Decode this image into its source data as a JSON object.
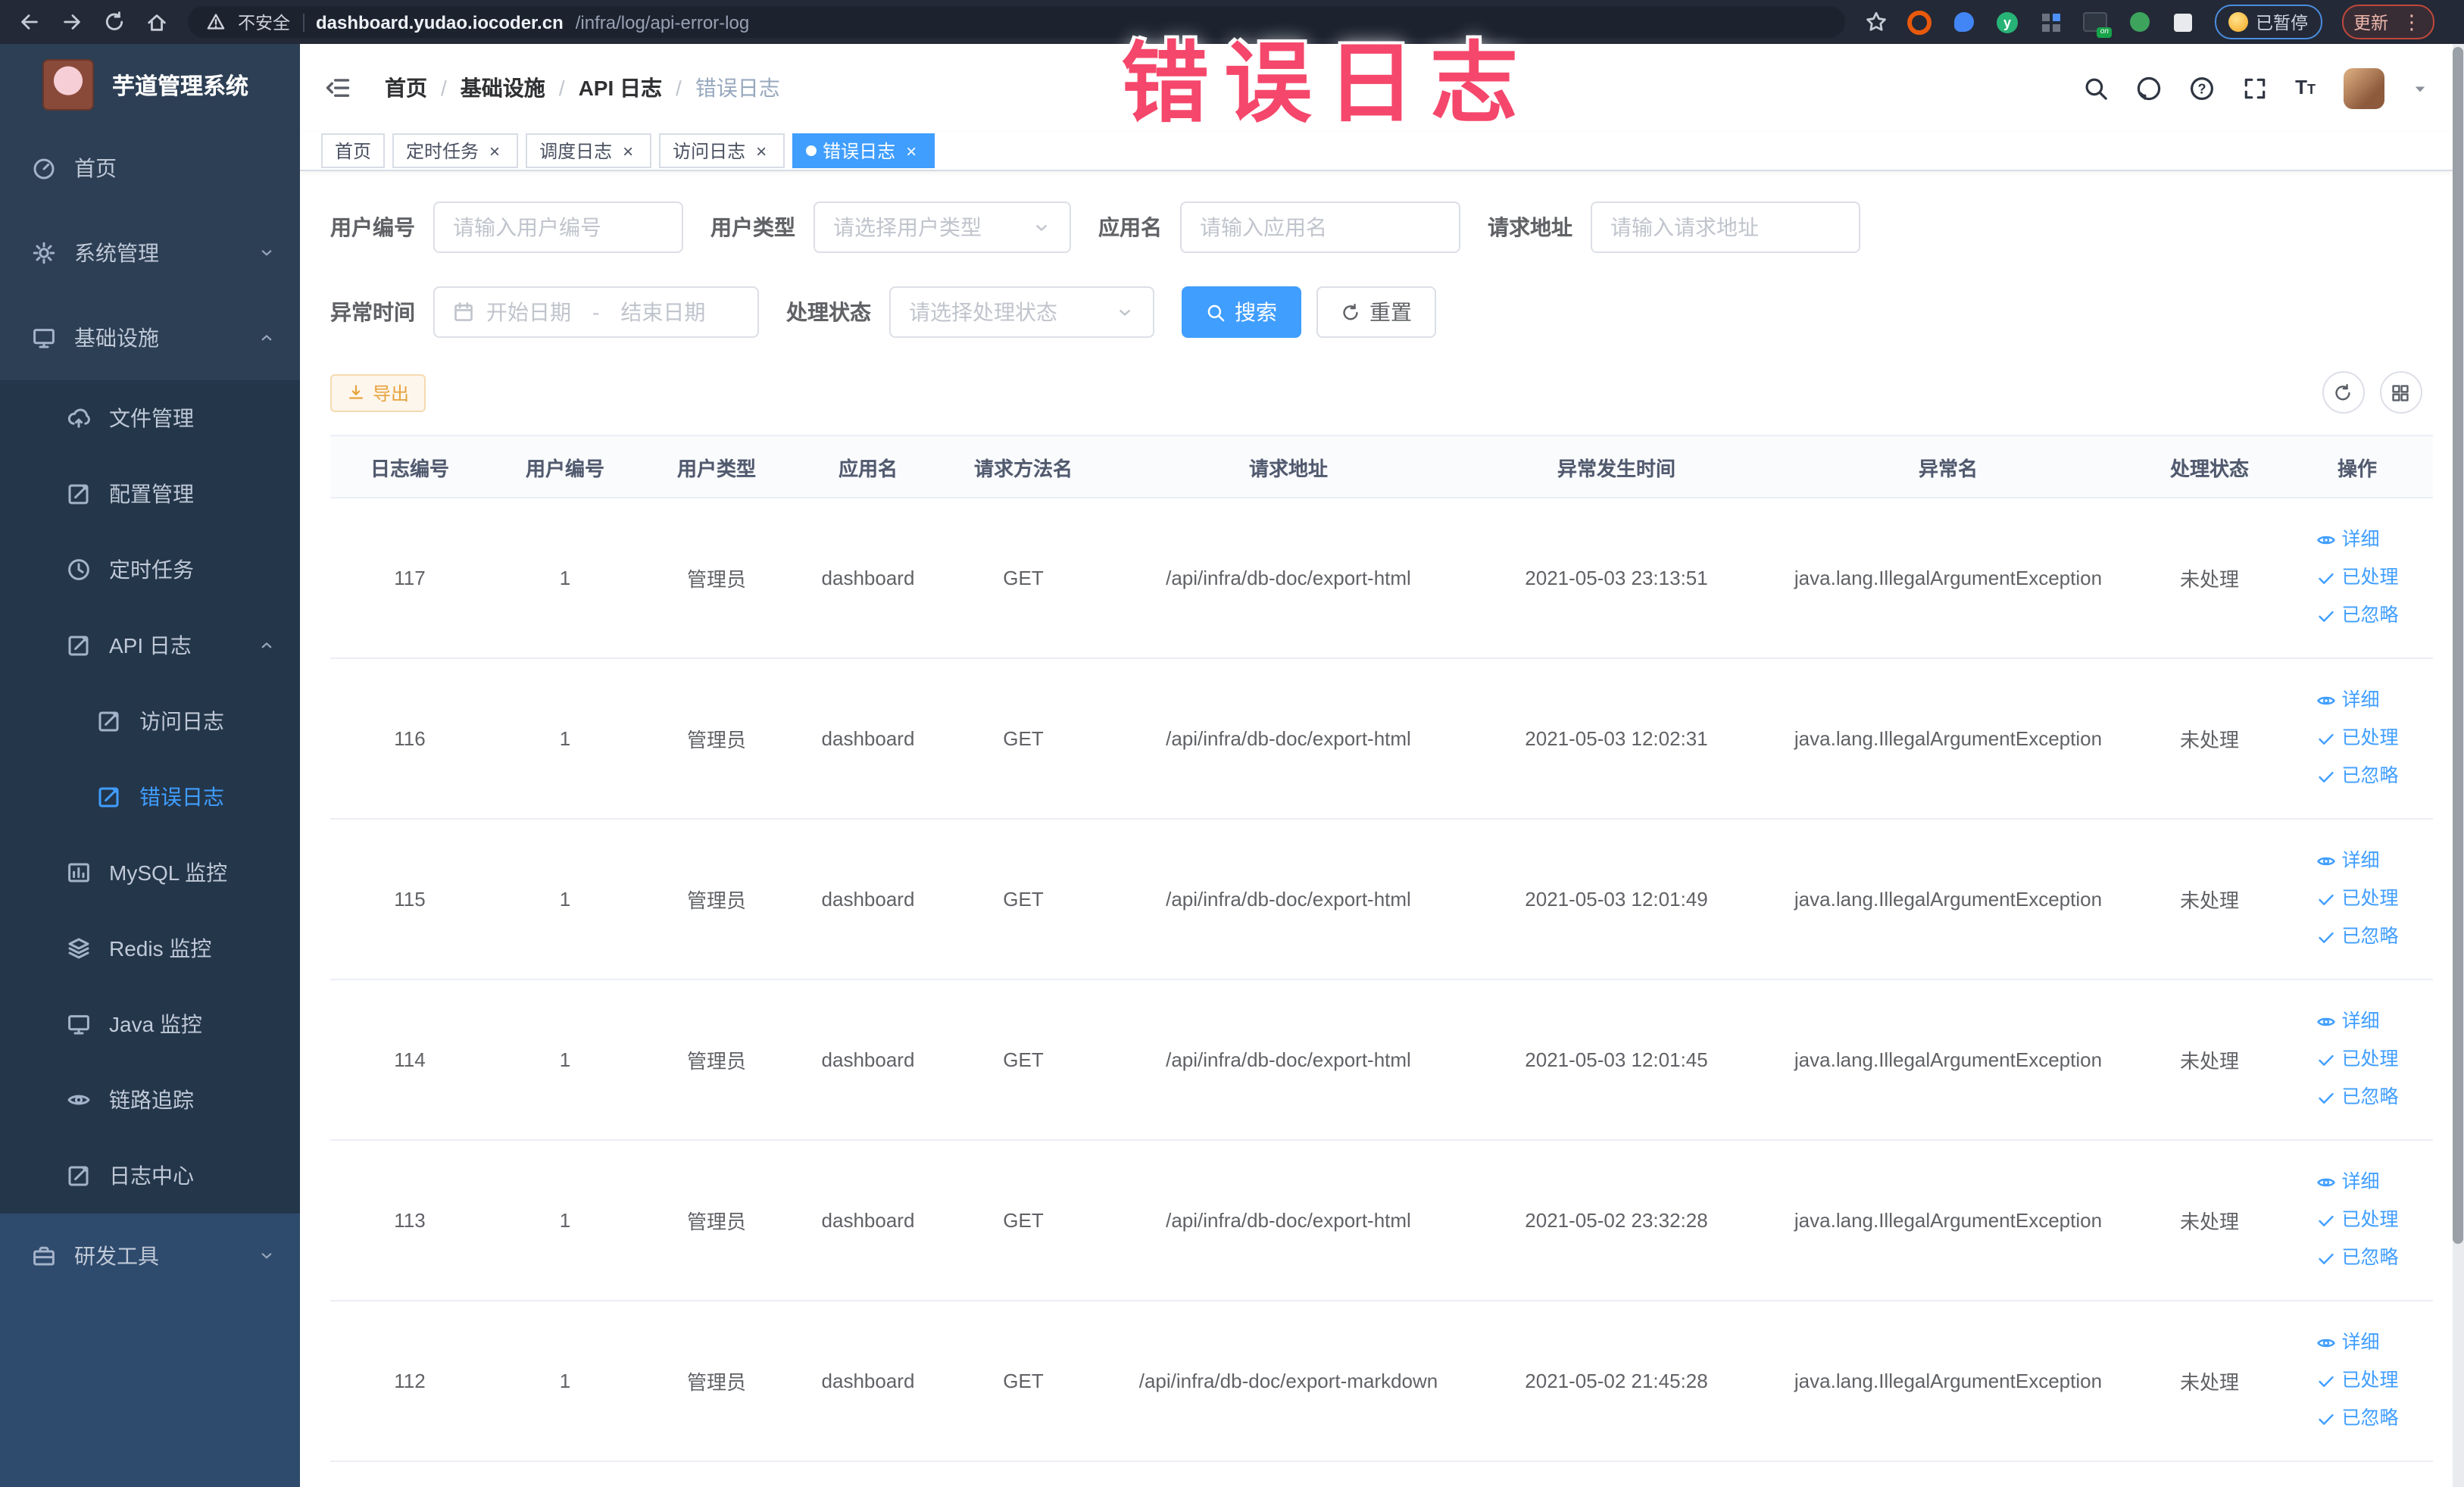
{
  "browser": {
    "security_label": "不安全",
    "url_host": "dashboard.yudao.iocoder.cn",
    "url_path": "/infra/log/api-error-log",
    "paused_label": "已暂停",
    "update_label": "更新"
  },
  "app": {
    "title": "芋道管理系统"
  },
  "watermark": {
    "text": "错误日志",
    "color": "#f5476b"
  },
  "colors": {
    "accent": "#409eff",
    "warning": "#e6a23c",
    "sidebar": "#2d3f54",
    "sidebar_sub": "#24364a",
    "sidebar_dev": "#2e4a6c"
  },
  "sidebar": {
    "items": [
      {
        "label": "首页",
        "icon": "dashboard",
        "level": 1,
        "section": "base"
      },
      {
        "label": "系统管理",
        "icon": "gear",
        "level": 1,
        "section": "base",
        "chevron": "down"
      },
      {
        "label": "基础设施",
        "icon": "monitor",
        "level": 1,
        "section": "base",
        "chevron": "up"
      },
      {
        "label": "文件管理",
        "icon": "cloud",
        "level": 2,
        "section": "sub"
      },
      {
        "label": "配置管理",
        "icon": "edit",
        "level": 2,
        "section": "sub"
      },
      {
        "label": "定时任务",
        "icon": "clock",
        "level": 2,
        "section": "sub"
      },
      {
        "label": "API 日志",
        "icon": "edit",
        "level": 2,
        "section": "sub",
        "chevron": "up"
      },
      {
        "label": "访问日志",
        "icon": "edit",
        "level": 3,
        "section": "sub"
      },
      {
        "label": "错误日志",
        "icon": "edit",
        "level": 3,
        "section": "sub",
        "active": true
      },
      {
        "label": "MySQL 监控",
        "icon": "chart",
        "level": 2,
        "section": "sub"
      },
      {
        "label": "Redis 监控",
        "icon": "layers",
        "level": 2,
        "section": "sub"
      },
      {
        "label": "Java 监控",
        "icon": "monitor",
        "level": 2,
        "section": "sub"
      },
      {
        "label": "链路追踪",
        "icon": "eye",
        "level": 2,
        "section": "sub"
      },
      {
        "label": "日志中心",
        "icon": "edit",
        "level": 2,
        "section": "sub"
      },
      {
        "label": "研发工具",
        "icon": "toolbox",
        "level": 1,
        "section": "dev",
        "chevron": "down"
      }
    ]
  },
  "header": {
    "breadcrumb": [
      "首页",
      "基础设施",
      "API 日志",
      "错误日志"
    ],
    "icons": [
      "search-icon",
      "github-icon",
      "help-icon",
      "fullscreen-icon",
      "font-size-icon"
    ]
  },
  "tabs": [
    {
      "label": "首页",
      "closable": false,
      "active": false
    },
    {
      "label": "定时任务",
      "closable": true,
      "active": false
    },
    {
      "label": "调度日志",
      "closable": true,
      "active": false
    },
    {
      "label": "访问日志",
      "closable": true,
      "active": false
    },
    {
      "label": "错误日志",
      "closable": true,
      "active": true
    }
  ],
  "filters": {
    "row1": [
      {
        "label": "用户编号",
        "type": "input",
        "placeholder": "请输入用户编号"
      },
      {
        "label": "用户类型",
        "type": "select",
        "placeholder": "请选择用户类型"
      },
      {
        "label": "应用名",
        "type": "input",
        "placeholder": "请输入应用名"
      },
      {
        "label": "请求地址",
        "type": "input",
        "placeholder": "请输入请求地址"
      }
    ],
    "row2": [
      {
        "label": "异常时间",
        "type": "daterange",
        "start_placeholder": "开始日期",
        "separator": "-",
        "end_placeholder": "结束日期"
      },
      {
        "label": "处理状态",
        "type": "select",
        "placeholder": "请选择处理状态"
      }
    ],
    "search_label": "搜索",
    "reset_label": "重置"
  },
  "toolbar": {
    "export_label": "导出"
  },
  "table": {
    "columns": [
      "日志编号",
      "用户编号",
      "用户类型",
      "应用名",
      "请求方法名",
      "请求地址",
      "异常发生时间",
      "异常名",
      "处理状态",
      "操作"
    ],
    "actions": [
      {
        "label": "详细",
        "icon": "eye"
      },
      {
        "label": "已处理",
        "icon": "check"
      },
      {
        "label": "已忽略",
        "icon": "check"
      }
    ],
    "rows": [
      {
        "id": "117",
        "user_id": "1",
        "user_type": "管理员",
        "app": "dashboard",
        "method": "GET",
        "url": "/api/infra/db-doc/export-html",
        "time": "2021-05-03 23:13:51",
        "exception": "java.lang.IllegalArgumentException",
        "status": "未处理"
      },
      {
        "id": "116",
        "user_id": "1",
        "user_type": "管理员",
        "app": "dashboard",
        "method": "GET",
        "url": "/api/infra/db-doc/export-html",
        "time": "2021-05-03 12:02:31",
        "exception": "java.lang.IllegalArgumentException",
        "status": "未处理"
      },
      {
        "id": "115",
        "user_id": "1",
        "user_type": "管理员",
        "app": "dashboard",
        "method": "GET",
        "url": "/api/infra/db-doc/export-html",
        "time": "2021-05-03 12:01:49",
        "exception": "java.lang.IllegalArgumentException",
        "status": "未处理"
      },
      {
        "id": "114",
        "user_id": "1",
        "user_type": "管理员",
        "app": "dashboard",
        "method": "GET",
        "url": "/api/infra/db-doc/export-html",
        "time": "2021-05-03 12:01:45",
        "exception": "java.lang.IllegalArgumentException",
        "status": "未处理"
      },
      {
        "id": "113",
        "user_id": "1",
        "user_type": "管理员",
        "app": "dashboard",
        "method": "GET",
        "url": "/api/infra/db-doc/export-html",
        "time": "2021-05-02 23:32:28",
        "exception": "java.lang.IllegalArgumentException",
        "status": "未处理"
      },
      {
        "id": "112",
        "user_id": "1",
        "user_type": "管理员",
        "app": "dashboard",
        "method": "GET",
        "url": "/api/infra/db-doc/export-markdown",
        "time": "2021-05-02 21:45:28",
        "exception": "java.lang.IllegalArgumentException",
        "status": "未处理"
      }
    ]
  }
}
